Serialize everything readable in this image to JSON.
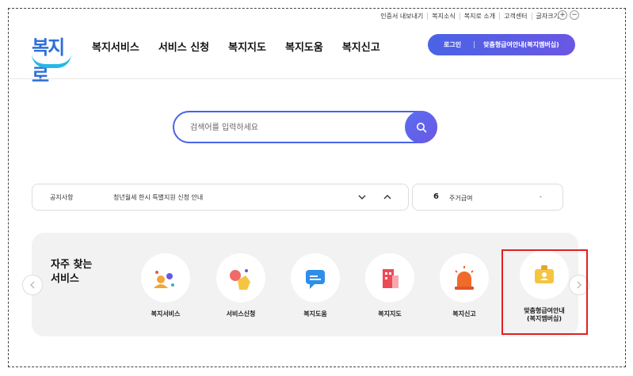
{
  "utility": {
    "items": [
      "인증서 내보내기",
      "복지소식",
      "복지로 소개",
      "고객센터",
      "글자크기"
    ],
    "plus": "+",
    "minus": "−"
  },
  "logo": {
    "text": "복지로"
  },
  "gnb": [
    "복지서비스",
    "서비스 신청",
    "복지지도",
    "복지도움",
    "복지신고"
  ],
  "header_actions": {
    "login": "로그인",
    "benefit": "맞춤형급여안내(복지멤버십)"
  },
  "search": {
    "placeholder": "검색어를 입력하세요"
  },
  "notice": {
    "label": "공지사항",
    "text": "청년월세 한시 특별지원 신청 안내"
  },
  "ranking": {
    "rank": "6",
    "term": "주거급여",
    "change": "-"
  },
  "frequent": {
    "title_line1": "자주 찾는",
    "title_line2": "서비스",
    "services": [
      {
        "label": "복지서비스",
        "icon": "welfare-service-icon"
      },
      {
        "label": "서비스신청",
        "icon": "service-apply-icon"
      },
      {
        "label": "복지도움",
        "icon": "welfare-help-icon"
      },
      {
        "label": "복지지도",
        "icon": "welfare-map-icon"
      },
      {
        "label": "복지신고",
        "icon": "welfare-report-icon"
      },
      {
        "label": "맞춤형급여안내\n(복지멤버십)",
        "label_line1": "맞춤형급여안내",
        "label_line2": "(복지멤버십)",
        "icon": "membership-icon"
      }
    ]
  },
  "colors": {
    "brand": "#4a63e6",
    "highlight": "#e02020",
    "panel": "#f2f2f2"
  }
}
